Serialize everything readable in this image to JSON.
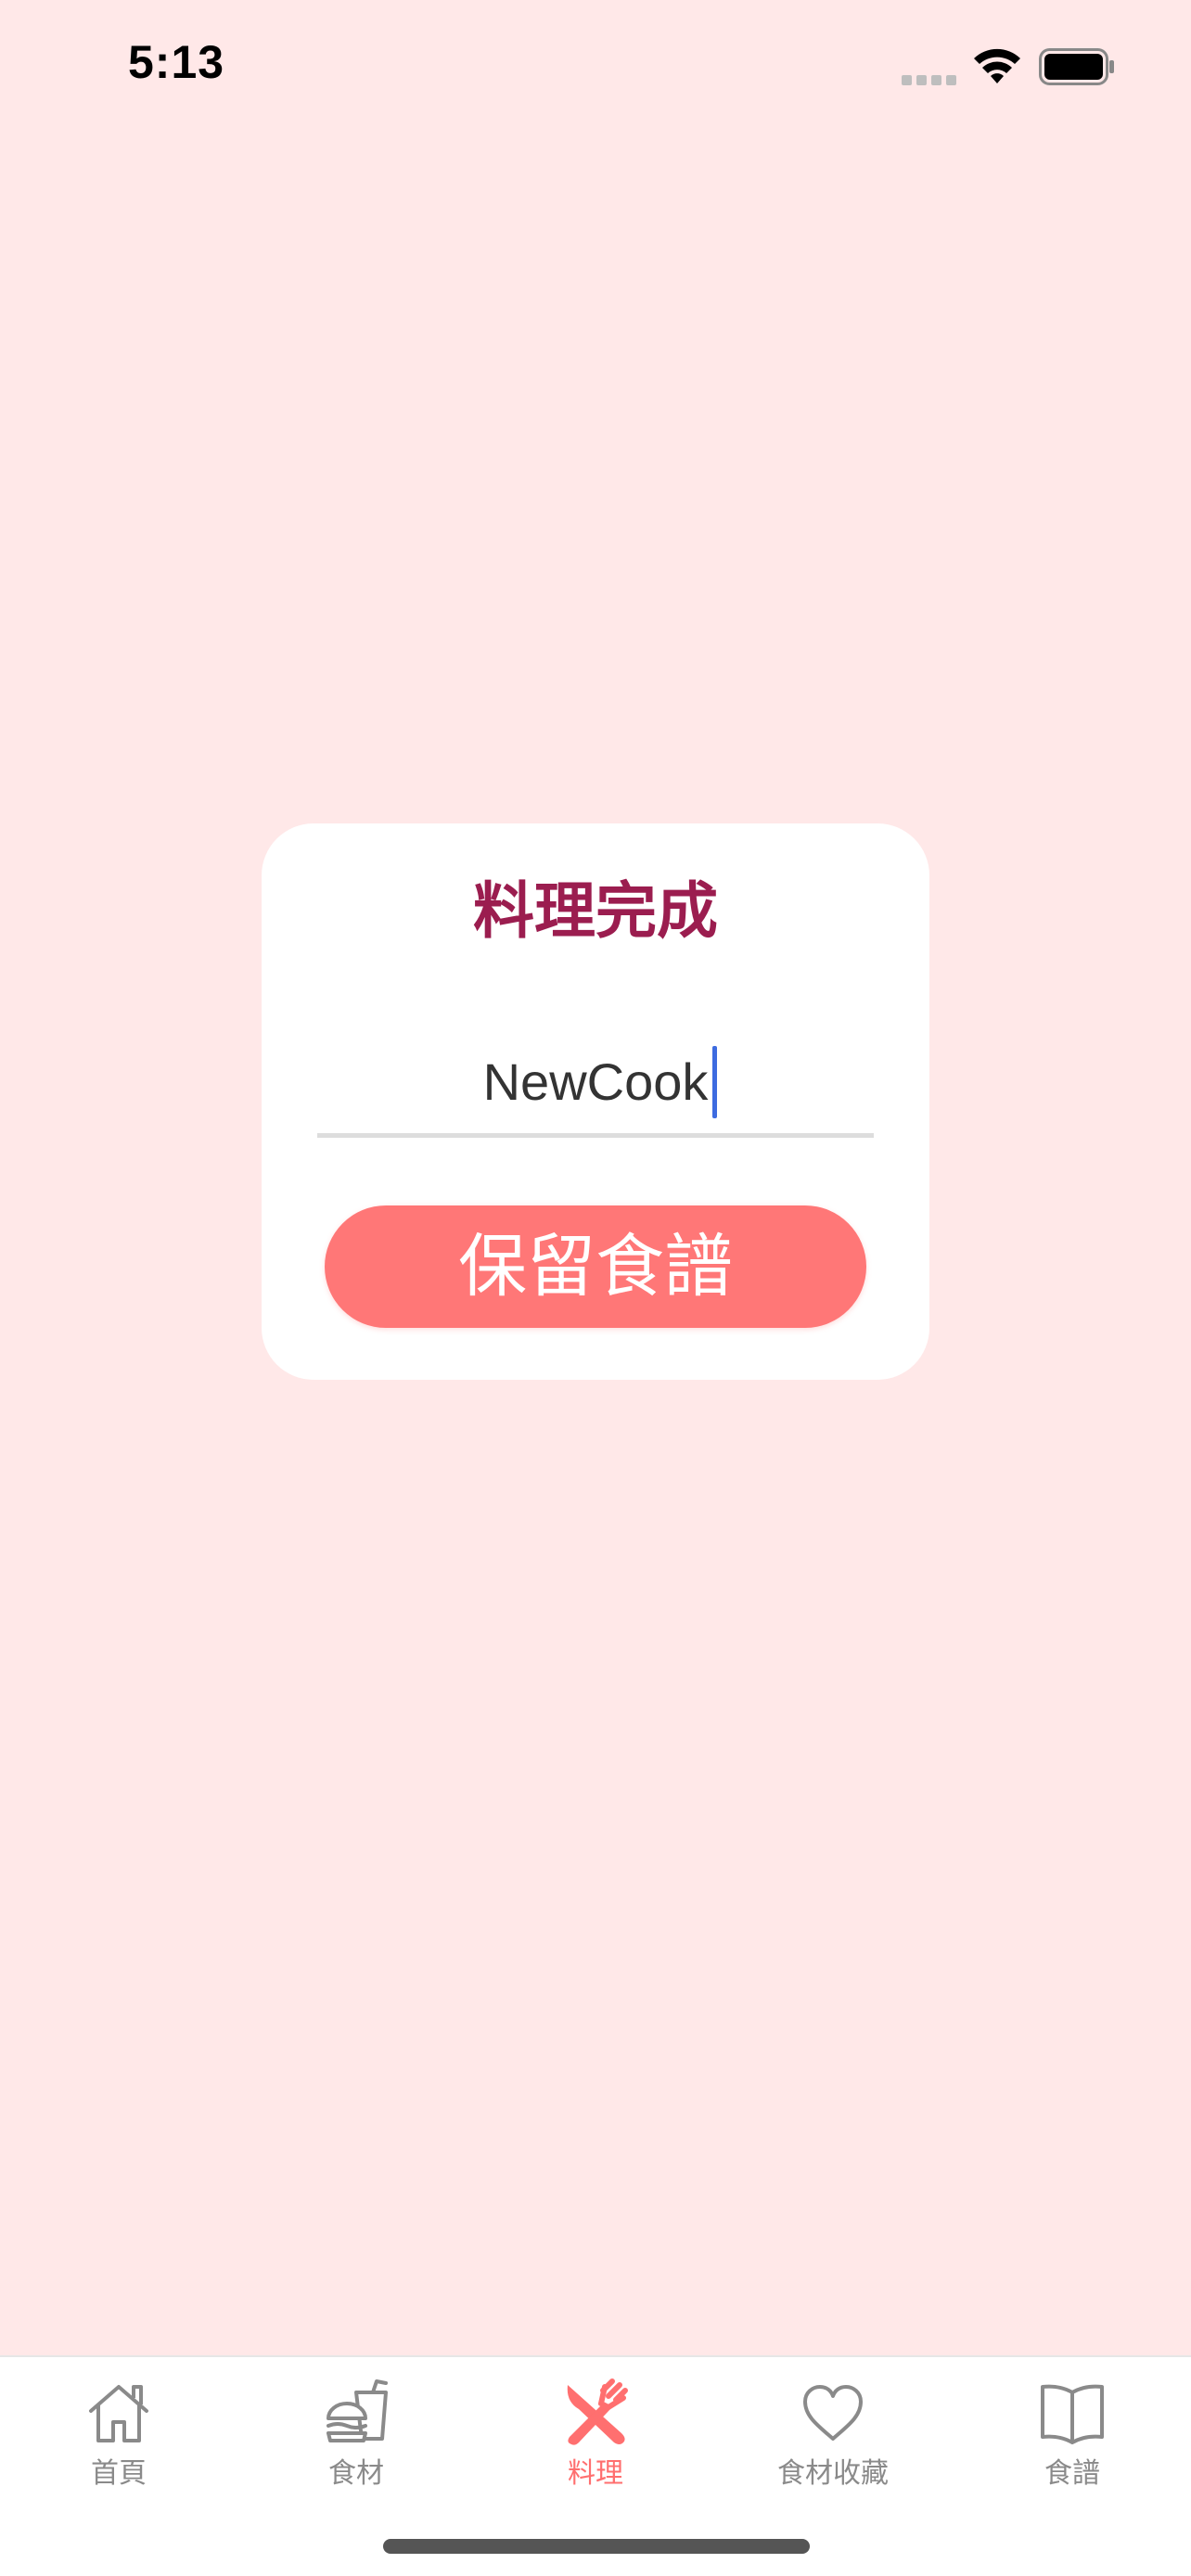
{
  "status_bar": {
    "time": "5:13"
  },
  "dialog": {
    "title": "料理完成",
    "recipe_name_value": "NewCook",
    "save_button_label": "保留食譜"
  },
  "tab_bar": {
    "active_tab": "料理",
    "tabs": [
      {
        "label": "首頁",
        "icon": "home-icon"
      },
      {
        "label": "食材",
        "icon": "food-icon"
      },
      {
        "label": "料理",
        "icon": "utensils-icon"
      },
      {
        "label": "食材收藏",
        "icon": "heart-icon"
      },
      {
        "label": "食譜",
        "icon": "book-icon"
      }
    ]
  },
  "colors": {
    "background": "#FFE8E8",
    "title": "#9B1D4F",
    "accent": "#FF7777",
    "active_tab": "#FF6F6F",
    "inactive_tab": "#8A8A8A"
  }
}
